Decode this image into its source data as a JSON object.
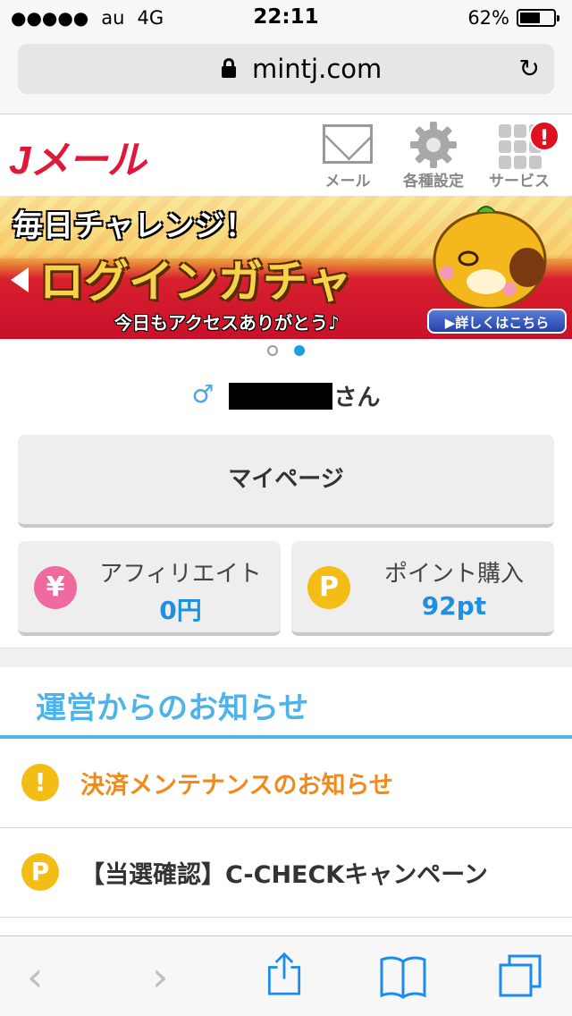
{
  "status_bar": {
    "signal": "●●●●●",
    "carrier": "au",
    "network": "4G",
    "time": "22:11",
    "battery": "62%",
    "battery_level": 0.62
  },
  "browser": {
    "domain": "mintj.com"
  },
  "header": {
    "logo": "Jメール",
    "nav": [
      {
        "label": "メール",
        "icon": "mail-icon"
      },
      {
        "label": "各種設定",
        "icon": "gear-icon"
      },
      {
        "label": "サービス",
        "icon": "grid-icon",
        "badge": "!"
      }
    ]
  },
  "banner": {
    "line1": "毎日チャレンジ！",
    "line2": "ログインガチャ",
    "line3": "今日もアクセスありがとう♪",
    "detail_button": "▶詳しくはこちら",
    "slide_count": 2,
    "active_slide": 2
  },
  "user": {
    "gender_symbol": "♂",
    "suffix": "さん"
  },
  "buttons": {
    "mypage": "マイページ",
    "affiliate": {
      "label": "アフィリエイト",
      "value": "0円",
      "icon_text": "¥",
      "color": "#f06aa0"
    },
    "points": {
      "label": "ポイント購入",
      "value": "92pt",
      "icon_text": "P",
      "color": "#f4bd16"
    }
  },
  "news": {
    "heading": "運営からのお知らせ",
    "items": [
      {
        "icon_text": "!",
        "text": "決済メンテナンスのお知らせ",
        "color": "#f08a1c"
      },
      {
        "icon_text": "P",
        "text": "【当選確認】C-CHECKキャンペーン",
        "color": "#333333"
      }
    ]
  },
  "toolbar": [
    "back-icon",
    "forward-icon",
    "share-icon",
    "bookmarks-icon",
    "tabs-icon"
  ],
  "colors": {
    "accent_blue": "#4db3ea",
    "brand_red": "#e0193a",
    "link_blue": "#1f8fe0"
  }
}
